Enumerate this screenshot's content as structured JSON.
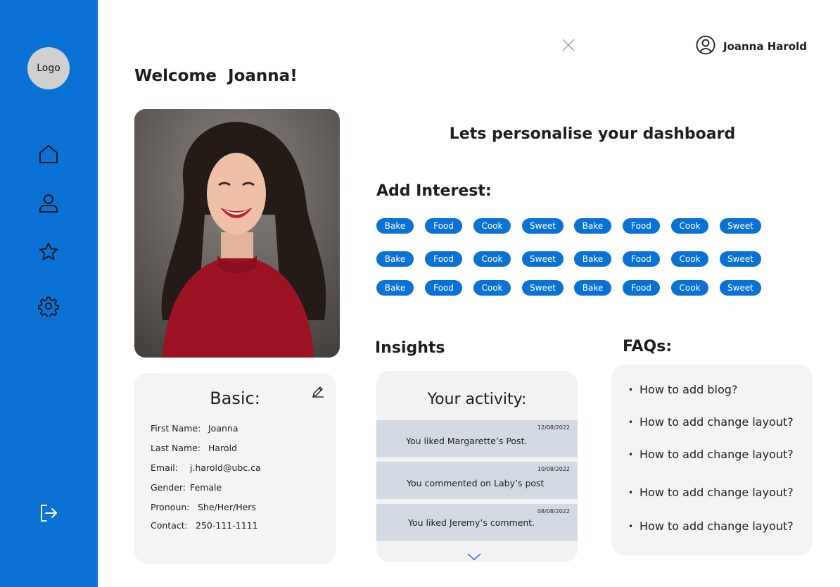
{
  "sidebar": {
    "logo": "Logo",
    "items": [
      {
        "icon": "home-icon"
      },
      {
        "icon": "user-icon"
      },
      {
        "icon": "star-icon"
      },
      {
        "icon": "gear-icon"
      }
    ],
    "logout_icon": "logout-icon"
  },
  "header": {
    "close_icon": "close-icon",
    "user_icon": "user-circle-icon",
    "user_name": "Joanna Harold"
  },
  "welcome": "Welcome  Joanna!",
  "basic": {
    "title": "Basic:",
    "edit_icon": "pencil-icon",
    "fields": [
      {
        "label": "First Name:",
        "value": "Joanna"
      },
      {
        "label": "Last Name:",
        "value": "Harold"
      },
      {
        "label": "Email:",
        "value": "j.harold@ubc.ca"
      },
      {
        "label": "Gender:",
        "value": "Female"
      },
      {
        "label": "Pronoun:",
        "value": "She/Her/Hers"
      },
      {
        "label": "Contact:",
        "value": "250-111-1111"
      }
    ]
  },
  "personalise": {
    "heading": "Lets personalise your dashboard",
    "add_interest": "Add Interest:",
    "chip_rows": [
      [
        "Bake",
        "Food",
        "Cook",
        "Sweet",
        "Bake",
        "Food",
        "Cook",
        "Sweet"
      ],
      [
        "Bake",
        "Food",
        "Cook",
        "Sweet",
        "Bake",
        "Food",
        "Cook",
        "Sweet"
      ],
      [
        "Bake",
        "Food",
        "Cook",
        "Sweet",
        "Bake",
        "Food",
        "Cook",
        "Sweet"
      ]
    ],
    "accent_color": "#0a72d4"
  },
  "insights": {
    "title": "Insights",
    "card_title": "Your activity:",
    "items": [
      {
        "date": "12/08/2022",
        "text": "You liked Margarette’s Post."
      },
      {
        "date": "10/08/2022",
        "text": "You commented on Laby’s post"
      },
      {
        "date": "08/08/2022",
        "text": "You liked Jeremy’s comment."
      }
    ],
    "more_icon": "chevron-down-icon"
  },
  "faqs": {
    "title": "FAQs:",
    "items": [
      "How to add blog?",
      "How to add change layout?",
      "How to add change layout?",
      "How to add change layout?",
      "How to add change layout?"
    ]
  }
}
